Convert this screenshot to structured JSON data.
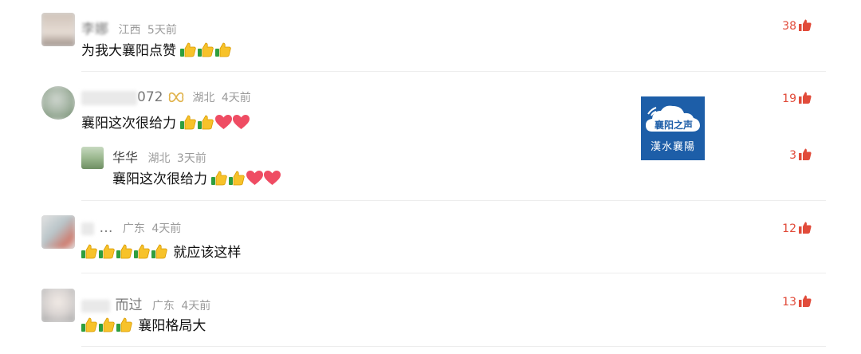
{
  "comments": [
    {
      "name": "李娜",
      "location": "江西",
      "time": "5天前",
      "text": "为我大襄阳点赞",
      "emoji_thumbs": 3,
      "likes": "38"
    },
    {
      "name": "072",
      "location": "湖北",
      "time": "4天前",
      "text": "襄阳这次很给力",
      "likes": "19",
      "reply": {
        "name": "华华",
        "location": "湖北",
        "time": "3天前",
        "text": "襄阳这次很给力",
        "likes": "3"
      }
    },
    {
      "name": "…",
      "location": "广东",
      "time": "4天前",
      "text": "就应该这样",
      "likes": "12"
    },
    {
      "name": "而过",
      "location": "广东",
      "time": "4天前",
      "text": "襄阳格局大",
      "likes": "13"
    }
  ],
  "logo": {
    "brand": "襄阳之声",
    "subtitle": "漢水襄陽"
  },
  "colors": {
    "likes": "#e14b3a",
    "heart": "#ef4c63",
    "logo_bg": "#1d5ea8"
  },
  "icons": [
    "thumbs-up-icon",
    "heart-icon",
    "vip-badge-icon"
  ]
}
